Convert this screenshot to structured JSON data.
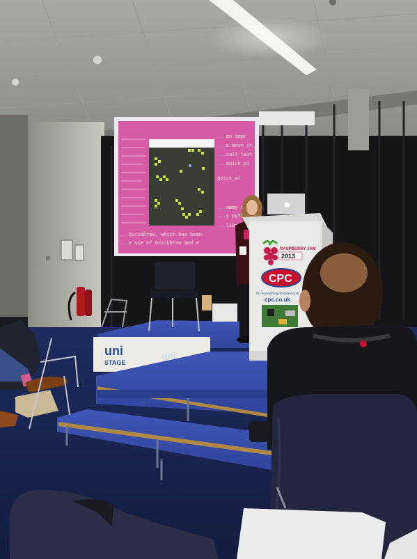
{
  "photo": {
    "screen_code_lines": [
      "...en depr",
      "...e move it",
      "...call last",
      "...quick_pi",
      "quick_wi",
      "...ammy m",
      "...y pytho",
      "...librar",
      "...QuickDraw, which has been",
      "...e use of QuickDraw and m"
    ],
    "podium": {
      "event_line_1": "RASPBERRY JAM",
      "event_year": "2013",
      "brand": "CPC",
      "tagline": "for everything Raspberry Pi",
      "url": "cpc.co.uk"
    },
    "stage": {
      "logo_main": "uni",
      "logo_sub": "STAGE"
    },
    "colors": {
      "screen_pink": "#d65aa6",
      "game_panel": "#3a3d33",
      "game_cells": "#c8e04a",
      "carpet": "#1c2a5a",
      "curtain": "#151518",
      "podium": "#e9eae8",
      "brand_red": "#c8102e"
    }
  }
}
